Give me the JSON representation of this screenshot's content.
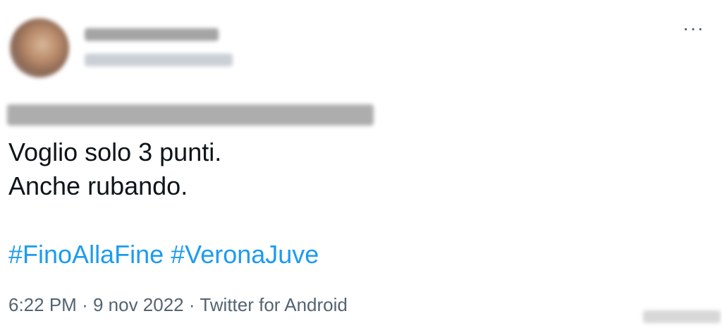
{
  "tweet": {
    "lines": [
      "Voglio solo 3 punti.",
      "Anche rubando."
    ],
    "hashtags": [
      "#FinoAllaFine",
      "#VeronaJuve"
    ],
    "time": "6:22 PM",
    "date": "9 nov 2022",
    "source": "Twitter for Android",
    "separator": "·"
  },
  "menu": {
    "more_glyph": "···",
    "more_icon": "more-options-icon"
  },
  "colors": {
    "link": "#1d9bf0",
    "text": "#0f1419",
    "muted": "#536471"
  }
}
